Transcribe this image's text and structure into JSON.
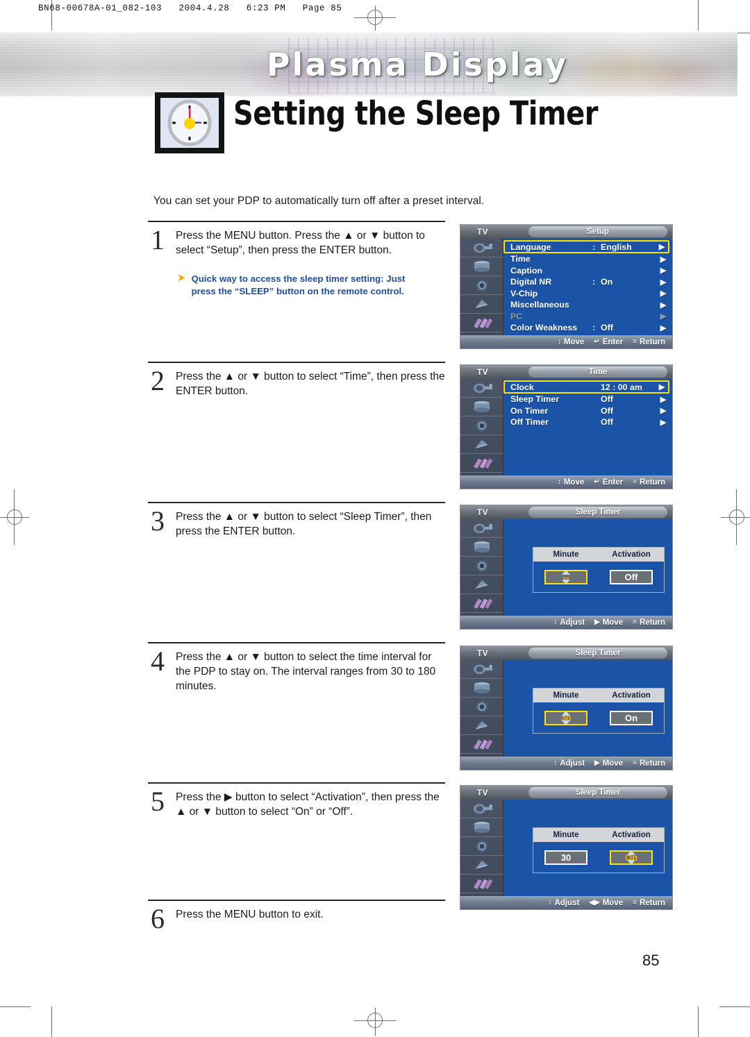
{
  "print_header": "BN68-00678A-01_082-103   2004.4.28   6:23 PM   Page 85",
  "banner": {
    "title": "Plasma Display"
  },
  "section": {
    "title": "Setting the Sleep Timer",
    "icon": "clock-icon"
  },
  "intro": "You can set your PDP to automatically turn off after a preset interval.",
  "page_number": "85",
  "colors": {
    "osd_blue": "#1b54a6",
    "highlight_yellow": "#ffe400",
    "value_amber": "#ffb100",
    "tip_blue": "#1d4f9c",
    "tip_arrow": "#f0a800"
  },
  "steps": [
    {
      "number": "1",
      "text": "Press the MENU button. Press the ▲ or ▼ button to select “Setup”, then press the ENTER button.",
      "tip": "Quick way to access the sleep timer setting: Just press the “SLEEP” button on the remote control."
    },
    {
      "number": "2",
      "text": "Press the ▲ or ▼ button to select “Time”, then press the ENTER button."
    },
    {
      "number": "3",
      "text": "Press the ▲ or ▼ button to select “Sleep Timer”, then press the ENTER button."
    },
    {
      "number": "4",
      "text": "Press the ▲ or ▼ button to select the time interval for the PDP to stay on. The interval ranges from 30 to 180 minutes."
    },
    {
      "number": "5",
      "text": "Press the ▶ button to select “Activation”, then press the ▲ or ▼ button to select “On” or “Off”."
    },
    {
      "number": "6",
      "text": "Press the MENU button to exit."
    }
  ],
  "osd": [
    {
      "id": "setup-menu",
      "source_label": "TV",
      "title": "Setup",
      "type": "list",
      "rows": [
        {
          "label": "Language",
          "sep": ":",
          "value": "English",
          "arrow": "▶",
          "selected": true,
          "dim": false
        },
        {
          "label": "Time",
          "sep": "",
          "value": "",
          "arrow": "▶",
          "selected": false,
          "dim": false
        },
        {
          "label": "Caption",
          "sep": "",
          "value": "",
          "arrow": "▶",
          "selected": false,
          "dim": false
        },
        {
          "label": "Digital NR",
          "sep": ":",
          "value": "On",
          "arrow": "▶",
          "selected": false,
          "dim": false
        },
        {
          "label": "V-Chip",
          "sep": "",
          "value": "",
          "arrow": "▶",
          "selected": false,
          "dim": false
        },
        {
          "label": "Miscellaneous",
          "sep": "",
          "value": "",
          "arrow": "▶",
          "selected": false,
          "dim": false
        },
        {
          "label": "PC",
          "sep": "",
          "value": "",
          "arrow": "▶",
          "selected": false,
          "dim": true
        },
        {
          "label": "Color Weakness",
          "sep": ":",
          "value": "Off",
          "arrow": "▶",
          "selected": false,
          "dim": false
        }
      ],
      "footer": [
        {
          "glyph": "↕",
          "label": "Move"
        },
        {
          "glyph": "↵",
          "label": "Enter"
        },
        {
          "glyph": "≡",
          "label": "Return"
        }
      ]
    },
    {
      "id": "time-menu",
      "source_label": "TV",
      "title": "Time",
      "type": "list",
      "rows": [
        {
          "label": "Clock",
          "sep": "",
          "value": "12 : 00 am",
          "arrow": "▶",
          "selected": true,
          "dim": false
        },
        {
          "label": "Sleep Timer",
          "sep": "",
          "value": "Off",
          "arrow": "▶",
          "selected": false,
          "dim": false
        },
        {
          "label": "On Timer",
          "sep": "",
          "value": "Off",
          "arrow": "▶",
          "selected": false,
          "dim": false
        },
        {
          "label": "Off Timer",
          "sep": "",
          "value": "Off",
          "arrow": "▶",
          "selected": false,
          "dim": false
        }
      ],
      "footer": [
        {
          "glyph": "↕",
          "label": "Move"
        },
        {
          "glyph": "↵",
          "label": "Enter"
        },
        {
          "glyph": "≡",
          "label": "Return"
        }
      ]
    },
    {
      "id": "sleep-timer-off",
      "source_label": "TV",
      "title": "Sleep Timer",
      "type": "sleep-table",
      "headers": {
        "minute": "Minute",
        "activation": "Activation"
      },
      "minute_value": "--",
      "activation_value": "Off",
      "selected_field": "minute",
      "footer": [
        {
          "glyph": "↕",
          "label": "Adjust"
        },
        {
          "glyph": "▶",
          "label": "Move"
        },
        {
          "glyph": "≡",
          "label": "Return"
        }
      ]
    },
    {
      "id": "sleep-timer-30-on",
      "source_label": "TV",
      "title": "Sleep Timer",
      "type": "sleep-table",
      "headers": {
        "minute": "Minute",
        "activation": "Activation"
      },
      "minute_value": "30",
      "activation_value": "On",
      "selected_field": "minute",
      "footer": [
        {
          "glyph": "↕",
          "label": "Adjust"
        },
        {
          "glyph": "▶",
          "label": "Move"
        },
        {
          "glyph": "≡",
          "label": "Return"
        }
      ]
    },
    {
      "id": "sleep-timer-activation-on",
      "source_label": "TV",
      "title": "Sleep Timer",
      "type": "sleep-table",
      "headers": {
        "minute": "Minute",
        "activation": "Activation"
      },
      "minute_value": "30",
      "activation_value": "On",
      "selected_field": "activation",
      "footer": [
        {
          "glyph": "↕",
          "label": "Adjust"
        },
        {
          "glyph": "◀▶",
          "label": "Move"
        },
        {
          "glyph": "≡",
          "label": "Return"
        }
      ]
    }
  ]
}
